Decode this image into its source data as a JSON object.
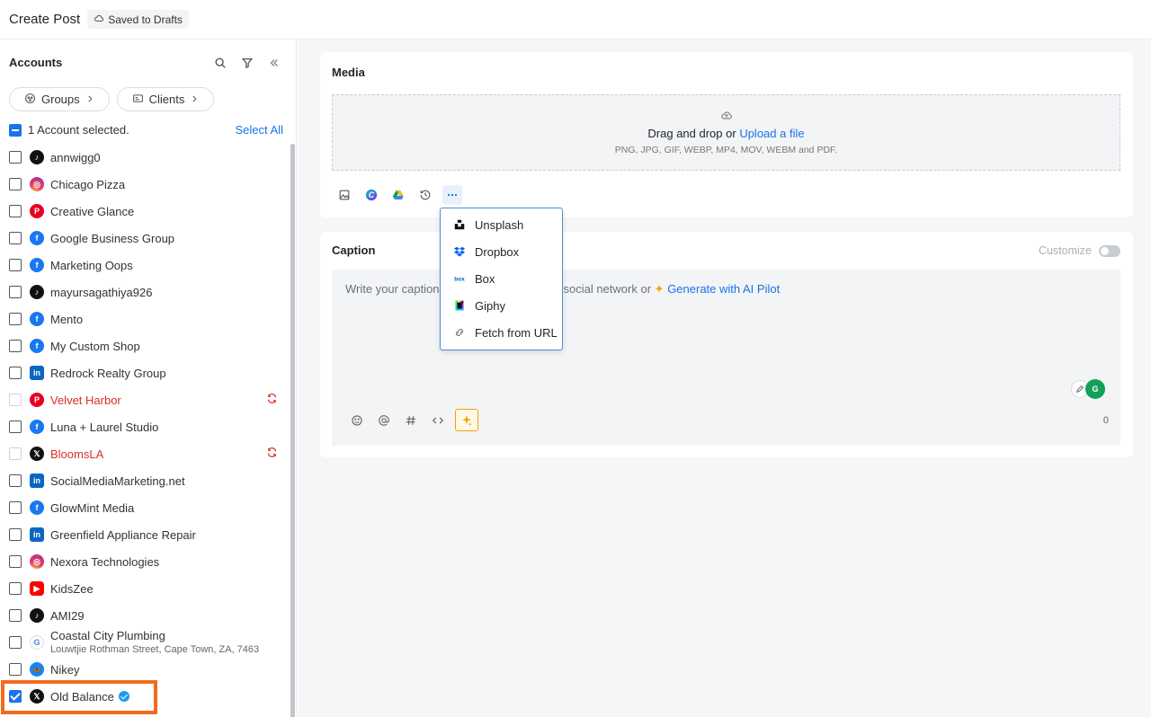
{
  "header": {
    "title": "Create Post",
    "draft_status": "Saved to Drafts"
  },
  "sidebar": {
    "heading": "Accounts",
    "groups_label": "Groups",
    "clients_label": "Clients",
    "selected_text": "1 Account selected.",
    "select_all": "Select All",
    "accounts": [
      {
        "name": "annwigg0",
        "network": "tiktok-icon"
      },
      {
        "name": "Chicago Pizza",
        "network": "instagram-icon"
      },
      {
        "name": "Creative Glance",
        "network": "pinterest-icon"
      },
      {
        "name": "Google Business Group",
        "network": "facebook-icon"
      },
      {
        "name": "Marketing Oops",
        "network": "facebook-icon"
      },
      {
        "name": "mayursagathiya926",
        "network": "tiktok-icon"
      },
      {
        "name": "Mento",
        "network": "facebook-icon"
      },
      {
        "name": "My Custom Shop",
        "network": "facebook-icon"
      },
      {
        "name": "Redrock Realty Group",
        "network": "linkedin-icon"
      },
      {
        "name": "Velvet Harbor",
        "network": "pinterest-icon",
        "status": "reconnect"
      },
      {
        "name": "Luna + Laurel Studio",
        "network": "facebook-icon"
      },
      {
        "name": "BloomsLA",
        "network": "x-icon",
        "status": "reconnect"
      },
      {
        "name": "SocialMediaMarketing.net",
        "network": "linkedin-icon"
      },
      {
        "name": "GlowMint Media",
        "network": "facebook-icon"
      },
      {
        "name": "Greenfield Appliance Repair",
        "network": "linkedin-icon"
      },
      {
        "name": "Nexora Technologies",
        "network": "instagram-icon"
      },
      {
        "name": "KidsZee",
        "network": "youtube-icon"
      },
      {
        "name": "AMI29",
        "network": "tiktok-icon"
      },
      {
        "name": "Coastal City Plumbing",
        "address": "Louwtjie Rothman Street, Cape Town, ZA, 7463",
        "network": "google-icon"
      },
      {
        "name": "Nikey",
        "network": "bluesky-icon"
      },
      {
        "name": "Old Balance",
        "network": "x-icon",
        "checked": true,
        "verified": true
      }
    ]
  },
  "media": {
    "title": "Media",
    "drop_text": "Drag and drop or",
    "upload_link": "Upload a file",
    "formats": "PNG, JPG, GIF, WEBP, MP4, MOV, WEBM and PDF.",
    "more_menu": [
      "Unsplash",
      "Dropbox",
      "Box",
      "Giphy",
      "Fetch from URL"
    ]
  },
  "caption": {
    "title": "Caption",
    "customize_label": "Customize",
    "placeholder_start": "Write your caption,",
    "placeholder_end": "ch social network or",
    "ai_link": "Generate with AI Pilot",
    "char_count": "0"
  },
  "colors": {
    "accent": "#1a73e8",
    "highlight": "#f26b1d",
    "error": "#d93025"
  }
}
